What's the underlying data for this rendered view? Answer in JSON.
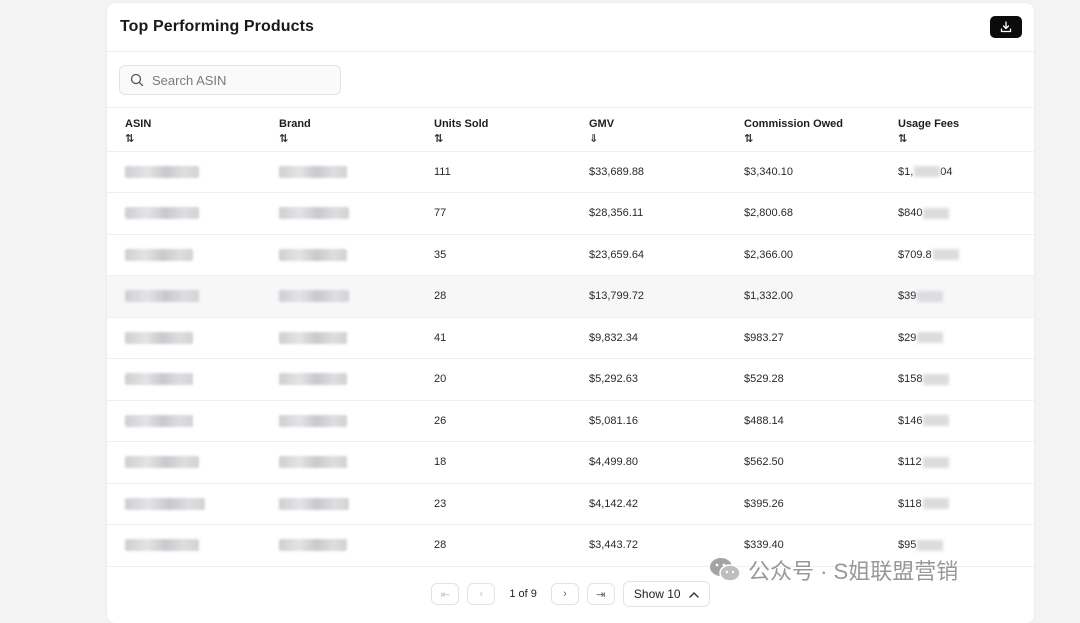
{
  "title": "Top Performing Products",
  "icons": {
    "download": "download-icon",
    "search": "search-icon",
    "sort": "sort-icon",
    "sort_desc": "sort-desc-icon"
  },
  "search": {
    "placeholder": "Search ASIN",
    "value": ""
  },
  "columns": [
    {
      "label": "ASIN",
      "sort": "⇅"
    },
    {
      "label": "Brand",
      "sort": "⇅"
    },
    {
      "label": "Units Sold",
      "sort": "⇅"
    },
    {
      "label": "GMV",
      "sort": "⇓"
    },
    {
      "label": "Commission Owed",
      "sort": "⇅"
    },
    {
      "label": "Usage Fees",
      "sort": "⇅"
    }
  ],
  "rows": [
    {
      "units": "111",
      "gmv": "$33,689.88",
      "commission": "$3,340.10",
      "fees_visible": "$1,",
      "fees_tail": "04"
    },
    {
      "units": "77",
      "gmv": "$28,356.11",
      "commission": "$2,800.68",
      "fees_visible": "$840",
      "fees_tail": ""
    },
    {
      "units": "35",
      "gmv": "$23,659.64",
      "commission": "$2,366.00",
      "fees_visible": "$709.8",
      "fees_tail": ""
    },
    {
      "units": "28",
      "gmv": "$13,799.72",
      "commission": "$1,332.00",
      "fees_visible": "$39",
      "fees_tail": ""
    },
    {
      "units": "41",
      "gmv": "$9,832.34",
      "commission": "$983.27",
      "fees_visible": "$29",
      "fees_tail": ""
    },
    {
      "units": "20",
      "gmv": "$5,292.63",
      "commission": "$529.28",
      "fees_visible": "$158",
      "fees_tail": ""
    },
    {
      "units": "26",
      "gmv": "$5,081.16",
      "commission": "$488.14",
      "fees_visible": "$146",
      "fees_tail": ""
    },
    {
      "units": "18",
      "gmv": "$4,499.80",
      "commission": "$562.50",
      "fees_visible": "$112",
      "fees_tail": ""
    },
    {
      "units": "23",
      "gmv": "$4,142.42",
      "commission": "$395.26",
      "fees_visible": "$118",
      "fees_tail": ""
    },
    {
      "units": "28",
      "gmv": "$3,443.72",
      "commission": "$339.40",
      "fees_visible": "$95",
      "fees_tail": ""
    }
  ],
  "pagination": {
    "page_text": "1 of 9",
    "show_label": "Show 10"
  },
  "watermark": "公众号 · S姐联盟营销"
}
